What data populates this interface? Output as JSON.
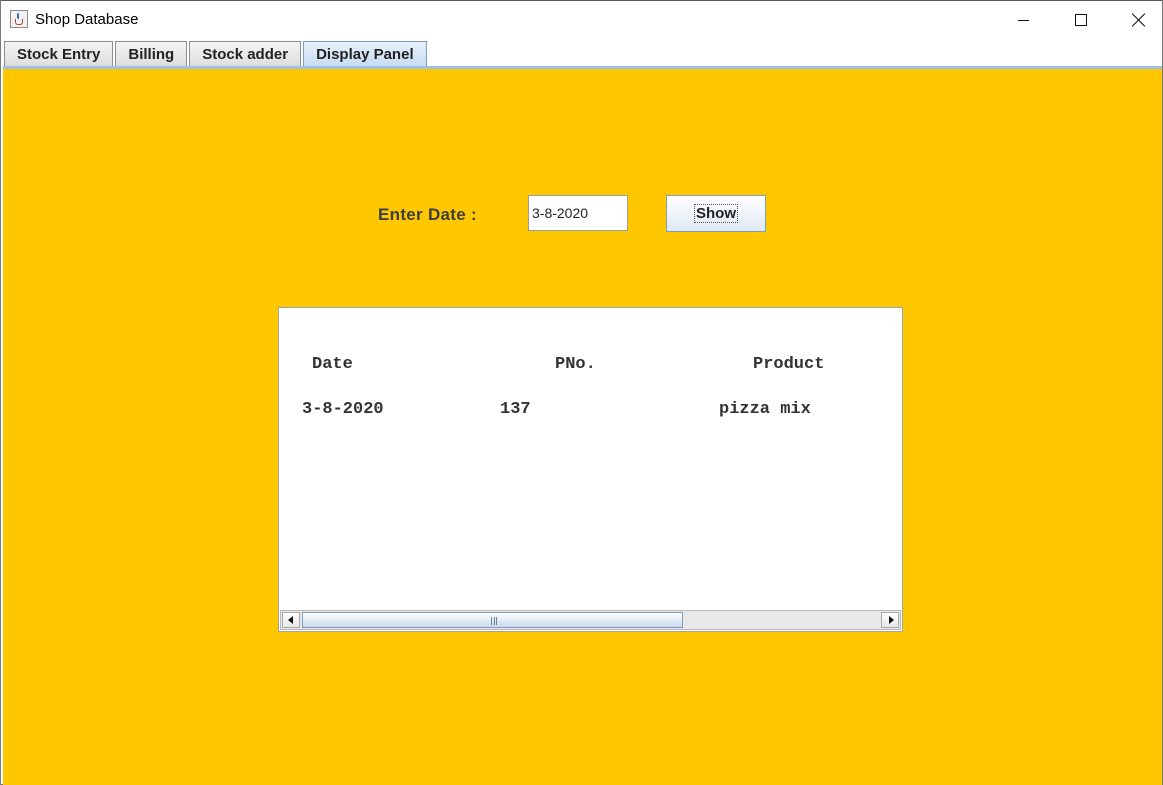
{
  "window": {
    "title": "Shop Database",
    "icon": "java-cup-icon",
    "controls": [
      "minimize-icon",
      "maximize-icon",
      "close-icon"
    ]
  },
  "tabs": [
    {
      "label": "Stock Entry",
      "active": false
    },
    {
      "label": "Billing",
      "active": false
    },
    {
      "label": "Stock adder",
      "active": false
    },
    {
      "label": "Display Panel",
      "active": true
    }
  ],
  "display_panel": {
    "enter_date_label": "Enter Date :",
    "date_value": "3-8-2020",
    "show_button_label": "Show",
    "background_color": "#ffc700",
    "results": {
      "columns": [
        "Date",
        "PNo.",
        "Product"
      ],
      "rows": [
        [
          "3-8-2020",
          "137",
          "pizza mix"
        ]
      ]
    }
  }
}
